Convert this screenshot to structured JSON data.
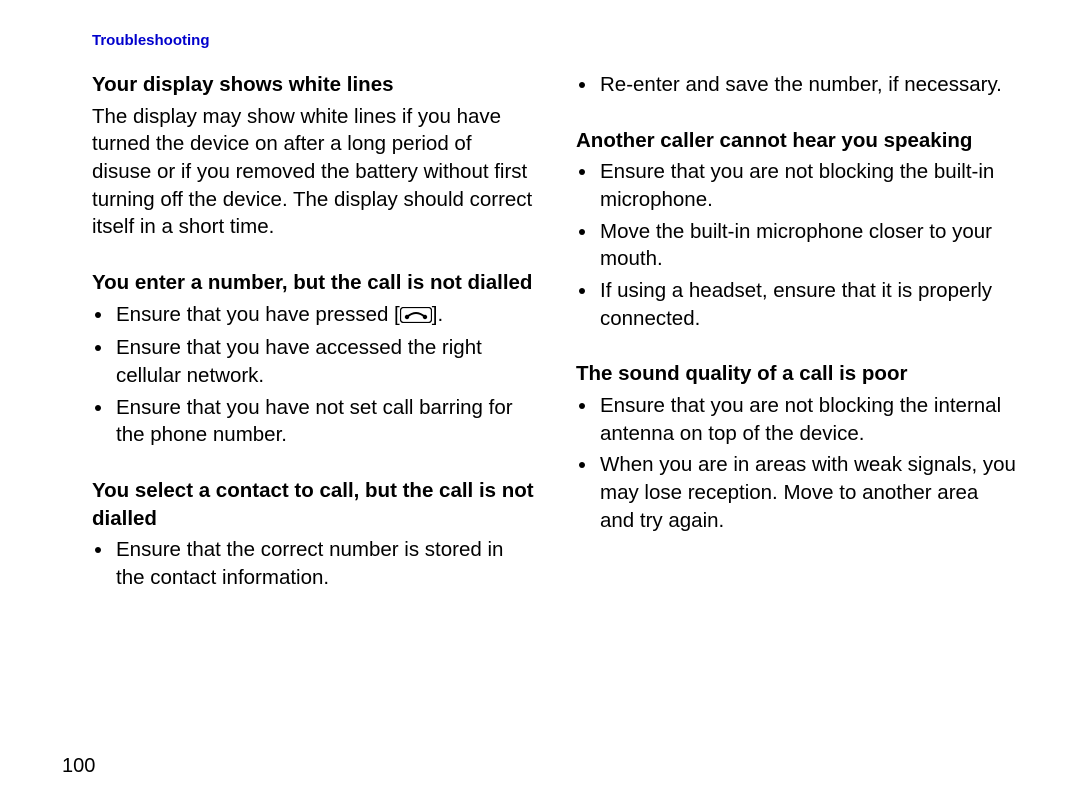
{
  "header": "Troubleshooting",
  "page_number": "100",
  "left": {
    "s1": {
      "heading": "Your display shows white lines",
      "body": "The display may show white lines if you have turned the device on after a long period of disuse or if you removed the battery without first turning off the device. The display should correct itself in a short time."
    },
    "s2": {
      "heading": "You enter a number, but the call is not dialled",
      "b1_pre": "Ensure that you have pressed [",
      "b1_post": "].",
      "b2": "Ensure that you have accessed the right cellular network.",
      "b3": "Ensure that you have not set call barring for the phone number."
    },
    "s3": {
      "heading": "You select a contact to call, but the call is not dialled",
      "b1": "Ensure that the correct number is stored in the contact information."
    }
  },
  "right": {
    "s0": {
      "b1": "Re-enter and save the number, if necessary."
    },
    "s1": {
      "heading": "Another caller cannot hear you speaking",
      "b1": "Ensure that you are not blocking the built-in microphone.",
      "b2": "Move the built-in microphone closer to your mouth.",
      "b3": "If using a headset, ensure that it is properly connected."
    },
    "s2": {
      "heading": "The sound quality of a call is poor",
      "b1": "Ensure that you are not blocking the internal antenna on top of the device.",
      "b2": "When you are in areas with weak signals, you may lose reception. Move to another area and try again."
    }
  }
}
